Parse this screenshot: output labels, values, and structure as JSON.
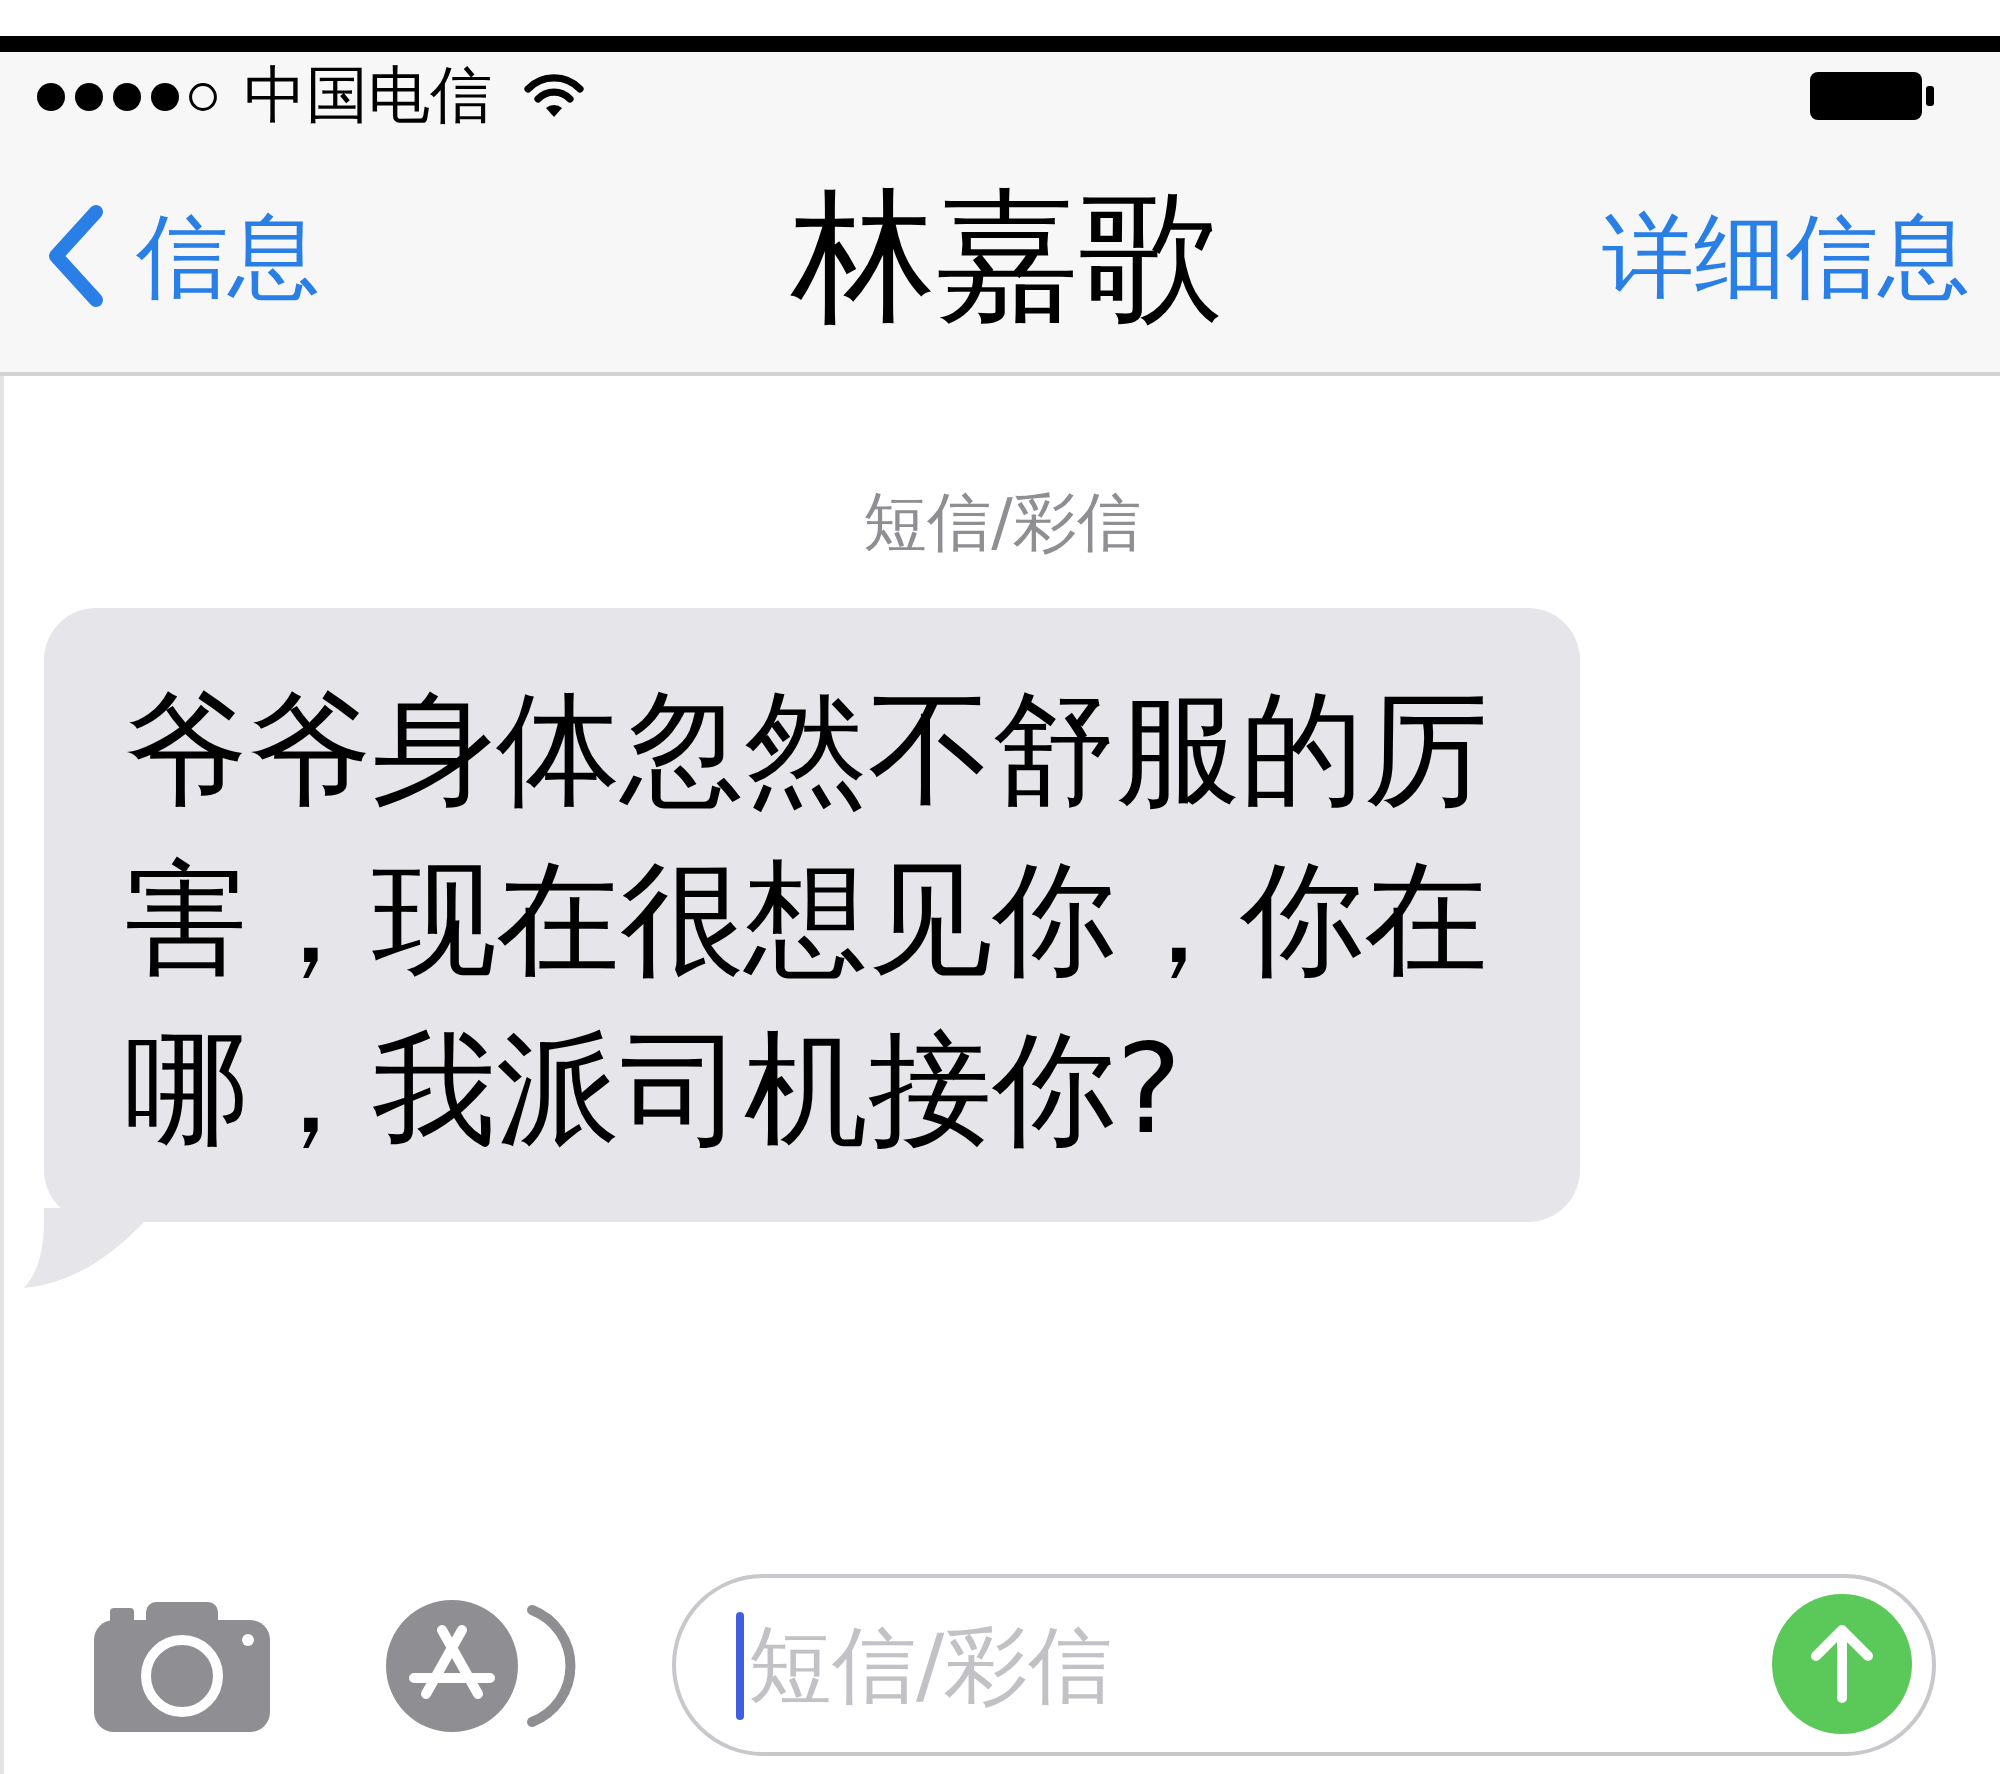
{
  "status_bar": {
    "carrier": "中国电信"
  },
  "nav_bar": {
    "back_label": "信息",
    "title": "林嘉歌",
    "detail_label": "详细信息"
  },
  "conversation": {
    "service_label": "短信/彩信",
    "messages": [
      {
        "kind": "received",
        "text": "爷爷身体忽然不舒服的厉害，现在很想见你，你在哪，我派司机接你?"
      }
    ]
  },
  "compose_bar": {
    "placeholder": "短信/彩信",
    "focused": true
  }
}
